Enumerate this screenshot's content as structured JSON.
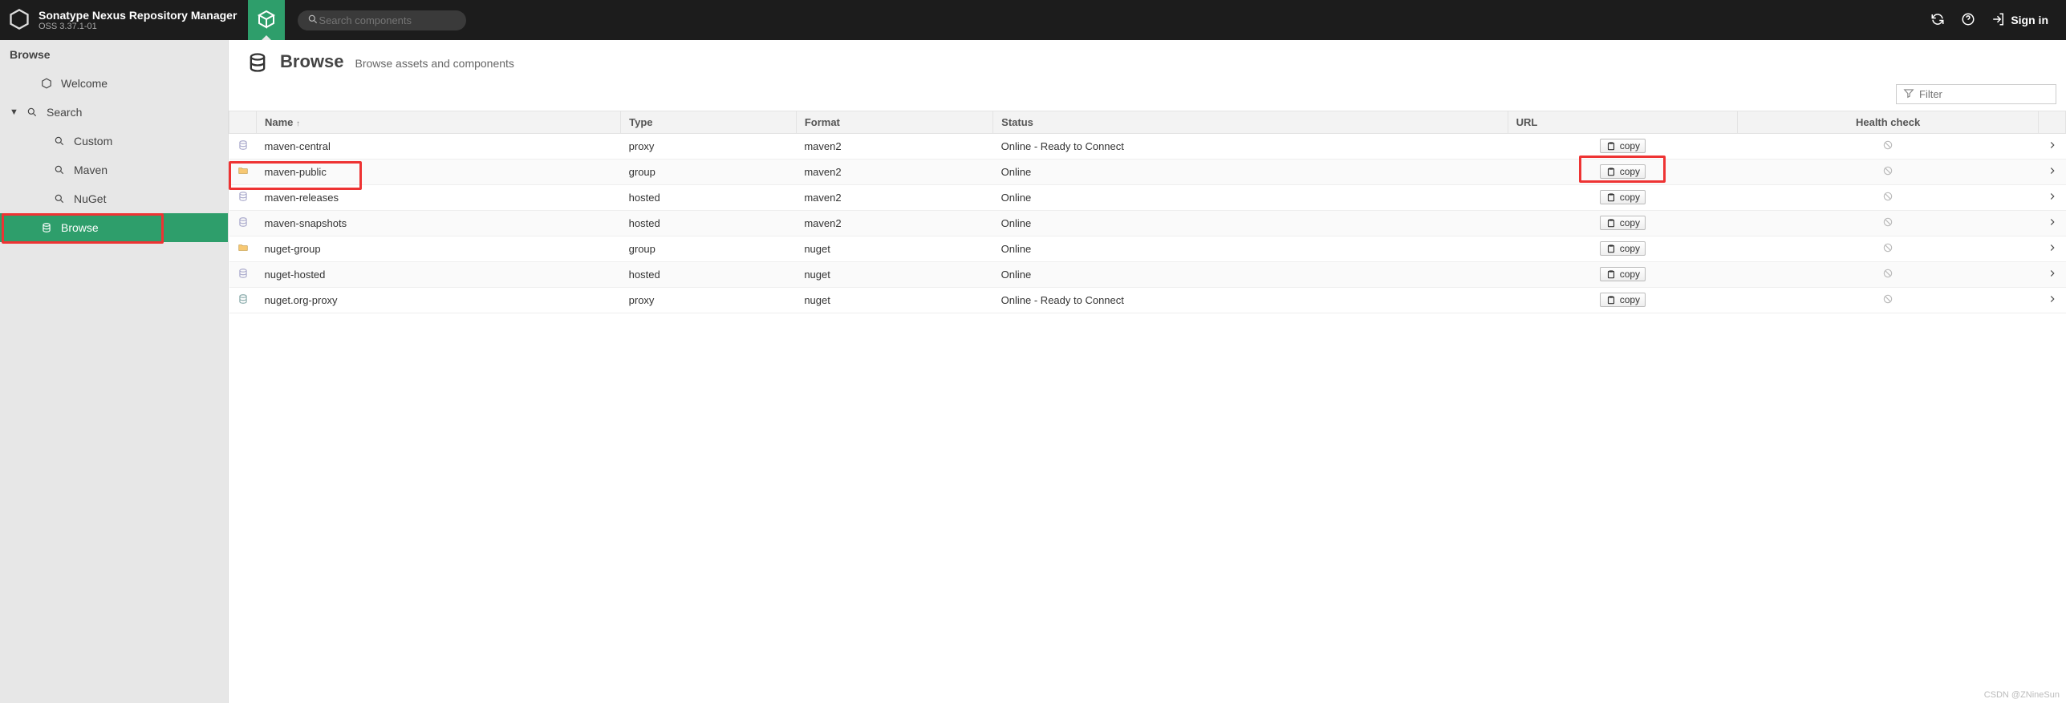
{
  "app": {
    "title": "Sonatype Nexus Repository Manager",
    "version": "OSS 3.37.1-01"
  },
  "topbar": {
    "search_placeholder": "Search components",
    "signin_label": "Sign in"
  },
  "sidebar": {
    "heading": "Browse",
    "items": [
      {
        "key": "welcome",
        "label": "Welcome",
        "icon": "hexagon",
        "level": 1,
        "expandable": false,
        "active": false
      },
      {
        "key": "search",
        "label": "Search",
        "icon": "magnify",
        "level": 0,
        "expandable": true,
        "expanded": true,
        "active": false
      },
      {
        "key": "custom",
        "label": "Custom",
        "icon": "magnify",
        "level": 2,
        "expandable": false,
        "active": false
      },
      {
        "key": "maven",
        "label": "Maven",
        "icon": "magnify",
        "level": 2,
        "expandable": false,
        "active": false
      },
      {
        "key": "nuget",
        "label": "NuGet",
        "icon": "magnify",
        "level": 2,
        "expandable": false,
        "active": false
      },
      {
        "key": "browse",
        "label": "Browse",
        "icon": "db",
        "level": 1,
        "expandable": false,
        "active": true,
        "highlight_red": true
      }
    ]
  },
  "page": {
    "title": "Browse",
    "subtitle": "Browse assets and components",
    "filter_placeholder": "Filter"
  },
  "table": {
    "columns": {
      "name": "Name",
      "type": "Type",
      "format": "Format",
      "status": "Status",
      "url": "URL",
      "health": "Health check"
    },
    "sort": {
      "column": "name",
      "direction": "asc"
    },
    "copy_label": "copy",
    "rows": [
      {
        "icon": "db",
        "name": "maven-central",
        "type": "proxy",
        "format": "maven2",
        "status": "Online - Ready to Connect",
        "highlight_red": false
      },
      {
        "icon": "folder-db",
        "name": "maven-public",
        "type": "group",
        "format": "maven2",
        "status": "Online",
        "highlight_red": true
      },
      {
        "icon": "db",
        "name": "maven-releases",
        "type": "hosted",
        "format": "maven2",
        "status": "Online",
        "highlight_red": false
      },
      {
        "icon": "db",
        "name": "maven-snapshots",
        "type": "hosted",
        "format": "maven2",
        "status": "Online",
        "highlight_red": false
      },
      {
        "icon": "folder-db",
        "name": "nuget-group",
        "type": "group",
        "format": "nuget",
        "status": "Online",
        "highlight_red": false
      },
      {
        "icon": "db",
        "name": "nuget-hosted",
        "type": "hosted",
        "format": "nuget",
        "status": "Online",
        "highlight_red": false
      },
      {
        "icon": "db-proxy",
        "name": "nuget.org-proxy",
        "type": "proxy",
        "format": "nuget",
        "status": "Online - Ready to Connect",
        "highlight_red": false
      }
    ]
  },
  "watermark": "CSDN @ZNineSun"
}
